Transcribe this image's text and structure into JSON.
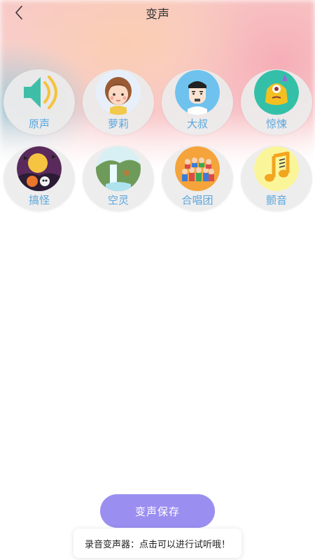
{
  "header": {
    "title": "变声",
    "back_icon": "chevron-left-icon"
  },
  "effects": [
    {
      "id": "original",
      "label": "原声",
      "icon": "speaker-icon"
    },
    {
      "id": "loli",
      "label": "萝莉",
      "icon": "girl-avatar-icon"
    },
    {
      "id": "uncle",
      "label": "大叔",
      "icon": "man-avatar-icon"
    },
    {
      "id": "horror",
      "label": "惊悚",
      "icon": "monster-icon"
    },
    {
      "id": "funny",
      "label": "搞怪",
      "icon": "halloween-icon"
    },
    {
      "id": "ethereal",
      "label": "空灵",
      "icon": "waterfall-icon"
    },
    {
      "id": "chorus",
      "label": "合唱团",
      "icon": "choir-icon"
    },
    {
      "id": "tremolo",
      "label": "颤音",
      "icon": "music-note-icon"
    }
  ],
  "actions": {
    "save_label": "变声保存"
  },
  "toast": {
    "message": "录音变声器：点击可以进行试听哦！"
  },
  "colors": {
    "accent": "#9a8ff0",
    "label": "#5aa6dc"
  }
}
